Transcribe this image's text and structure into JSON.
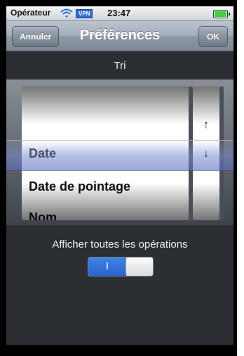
{
  "status_bar": {
    "carrier": "Opérateur",
    "vpn": "VPN",
    "time": "23:47"
  },
  "nav": {
    "cancel_label": "Annuler",
    "title": "Préférences",
    "ok_label": "OK"
  },
  "sort": {
    "title": "Tri",
    "options": [
      "Date",
      "Date de pointage",
      "Nom"
    ],
    "selected": "Date",
    "direction_up": "↑",
    "direction_down": "↓"
  },
  "show_all": {
    "label": "Afficher toutes les opérations",
    "toggle_on_text": "I",
    "value": true
  },
  "colors": {
    "toggle_on": "#3e83e8",
    "battery": "#3fd03a",
    "vpn": "#2e6fd1",
    "screen_bg": "#2b2e33"
  }
}
